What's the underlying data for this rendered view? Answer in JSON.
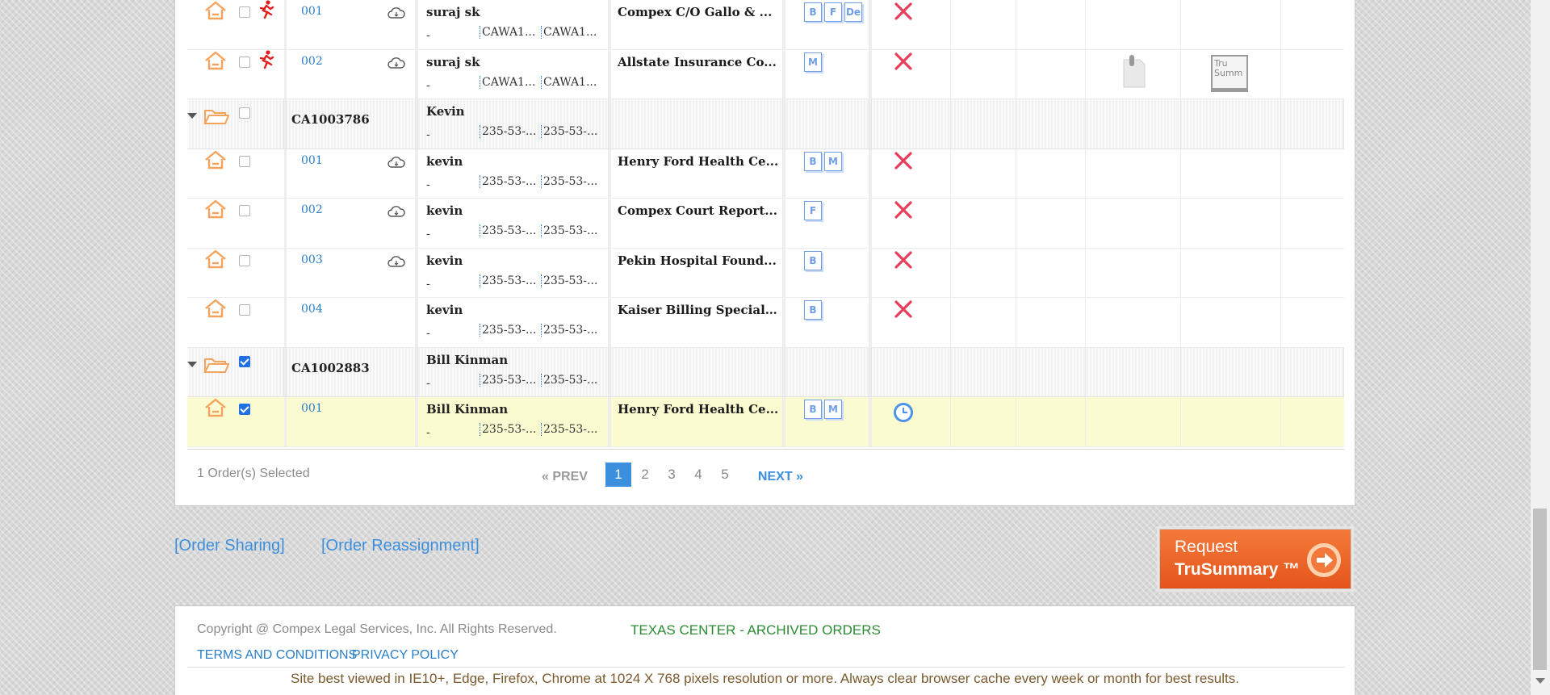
{
  "orders": [
    {
      "type": "order",
      "checked": false,
      "runner": true,
      "order_no": "001",
      "cloud": true,
      "name": "suraj sk",
      "dash": "-",
      "seg1": "CAWA1...",
      "seg2": "CAWA1...",
      "facility": "Compex C/O Gallo & ...",
      "docs": [
        "B",
        "F",
        "De"
      ],
      "status": "x"
    },
    {
      "type": "order",
      "checked": false,
      "runner": true,
      "order_no": "002",
      "cloud": true,
      "name": "suraj sk",
      "dash": "-",
      "seg1": "CAWA1...",
      "seg2": "CAWA1...",
      "facility": "Allstate Insurance Co...",
      "docs": [
        "M"
      ],
      "status": "x",
      "clip": true,
      "tru": "Tru Summ"
    },
    {
      "type": "group",
      "checked": false,
      "case_no": "CA1003786",
      "name": "Kevin",
      "dash": "-",
      "seg1": "235-53-...",
      "seg2": "235-53-..."
    },
    {
      "type": "order",
      "checked": false,
      "order_no": "001",
      "cloud": true,
      "name": "kevin",
      "dash": "-",
      "seg1": "235-53-...",
      "seg2": "235-53-...",
      "facility": "Henry Ford Health Ce...",
      "docs": [
        "B",
        "M"
      ],
      "status": "x"
    },
    {
      "type": "order",
      "checked": false,
      "order_no": "002",
      "cloud": true,
      "name": "kevin",
      "dash": "-",
      "seg1": "235-53-...",
      "seg2": "235-53-...",
      "facility": "Compex Court Report...",
      "docs": [
        "F"
      ],
      "status": "x"
    },
    {
      "type": "order",
      "checked": false,
      "order_no": "003",
      "cloud": true,
      "name": "kevin",
      "dash": "-",
      "seg1": "235-53-...",
      "seg2": "235-53-...",
      "facility": "Pekin Hospital Found...",
      "docs": [
        "B"
      ],
      "status": "x"
    },
    {
      "type": "order",
      "checked": false,
      "order_no": "004",
      "cloud": false,
      "name": "kevin",
      "dash": "-",
      "seg1": "235-53-...",
      "seg2": "235-53-...",
      "facility": "Kaiser Billing Special ...",
      "docs": [
        "B"
      ],
      "status": "x"
    },
    {
      "type": "group",
      "checked": true,
      "case_no": "CA1002883",
      "name": "Bill Kinman",
      "dash": "-",
      "seg1": "235-53-...",
      "seg2": "235-53-..."
    },
    {
      "type": "order",
      "checked": true,
      "selected": true,
      "order_no": "001",
      "cloud": false,
      "name": "Bill Kinman",
      "dash": "-",
      "seg1": "235-53-...",
      "seg2": "235-53-...",
      "facility": "Henry Ford Health Ce...",
      "docs": [
        "B",
        "M"
      ],
      "status": "clock"
    }
  ],
  "footer_bar": {
    "selected_count": "1 Order(s) Selected",
    "prev": "« PREV",
    "pages": [
      "1",
      "2",
      "3",
      "4",
      "5"
    ],
    "active_page": "1",
    "next": "NEXT »"
  },
  "actions": {
    "order_sharing": "[Order Sharing]",
    "order_reassignment": "[Order Reassignment]",
    "request_line1": "Request",
    "request_line2": "TruSummary ™"
  },
  "footer": {
    "copyright": "Copyright @ Compex Legal Services, Inc. All Rights Reserved.",
    "archived": "TEXAS CENTER - ARCHIVED ORDERS",
    "terms": "TERMS AND CONDITIONS",
    "privacy": "PRIVACY POLICY",
    "best_viewed": "Site best viewed in IE10+, Edge, Firefox, Chrome at 1024 X 768 pixels resolution or more. Always clear browser cache every week or month for best results."
  },
  "colors": {
    "accent": "#3c8fdc",
    "icon_orange": "#f5a35c",
    "danger": "#e83e5c",
    "selected_row": "#fbfbd2",
    "archived_green": "#2d8a34"
  }
}
